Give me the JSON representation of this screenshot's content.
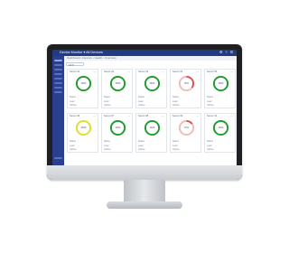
{
  "app": {
    "title": "Device Monitor ▾ All Devices",
    "titlebar_icons": "⚙ ? ☰",
    "breadcrumb": "Dashboard › Devices › Health › Overview",
    "filter_label": "All ▾"
  },
  "colors": {
    "ok": "#1e9a2c",
    "warn": "#e4dc2a",
    "error": "#d9534f",
    "error_light": "#f2b9b7"
  },
  "cards": [
    {
      "title": "Server 01",
      "status": "ok",
      "fill": 1.0,
      "center": "100%",
      "labels": [
        "Status",
        "Load",
        "Uptime"
      ]
    },
    {
      "title": "Server 02",
      "status": "ok",
      "fill": 1.0,
      "center": "100%",
      "labels": [
        "Status",
        "Load",
        "Uptime"
      ]
    },
    {
      "title": "Server 03",
      "status": "ok",
      "fill": 1.0,
      "center": "100%",
      "labels": [
        "Status",
        "Load",
        "Uptime"
      ]
    },
    {
      "title": "Server 04",
      "status": "error",
      "fill": 0.35,
      "center": "35%",
      "labels": [
        "Status",
        "Load",
        "Uptime"
      ]
    },
    {
      "title": "Server 05",
      "status": "ok",
      "fill": 1.0,
      "center": "100%",
      "labels": [
        "Status",
        "Load",
        "Uptime"
      ]
    },
    {
      "title": "Server 06",
      "status": "warn",
      "fill": 1.0,
      "center": "100%",
      "labels": [
        "Status",
        "Load",
        "Uptime"
      ]
    },
    {
      "title": "Server 07",
      "status": "ok",
      "fill": 1.0,
      "center": "100%",
      "labels": [
        "Status",
        "Load",
        "Uptime"
      ]
    },
    {
      "title": "Server 08",
      "status": "ok",
      "fill": 1.0,
      "center": "100%",
      "labels": [
        "Status",
        "Load",
        "Uptime"
      ]
    },
    {
      "title": "Server 09",
      "status": "error",
      "fill": 0.15,
      "center": "15%",
      "labels": [
        "Status",
        "Load",
        "Uptime"
      ]
    },
    {
      "title": "Server 10",
      "status": "ok",
      "fill": 1.0,
      "center": "100%",
      "labels": [
        "Status",
        "Load",
        "Uptime"
      ]
    }
  ]
}
